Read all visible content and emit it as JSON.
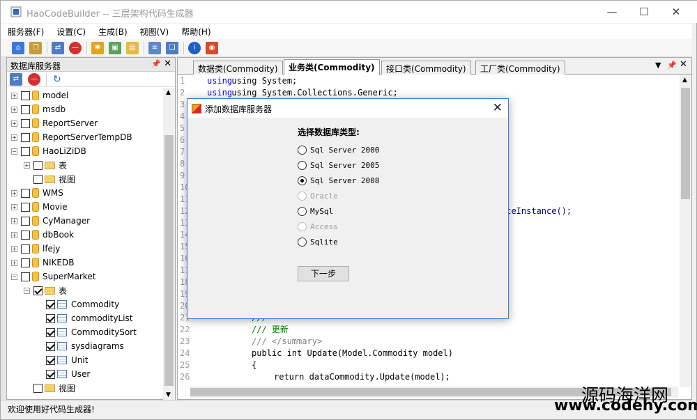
{
  "window": {
    "title": "HaoCodeBuilder -- 三层架构代码生成器"
  },
  "menu": [
    "服务器(F)",
    "设置(C)",
    "生成(B)",
    "视图(V)",
    "帮助(H)"
  ],
  "left_pane": {
    "title": "数据库服务器",
    "tree": [
      {
        "label": "model",
        "type": "db",
        "depth": 0
      },
      {
        "label": "msdb",
        "type": "db",
        "depth": 0
      },
      {
        "label": "ReportServer",
        "type": "db",
        "depth": 0
      },
      {
        "label": "ReportServerTempDB",
        "type": "db",
        "depth": 0
      },
      {
        "label": "HaoLiZiDB",
        "type": "db",
        "depth": 0
      },
      {
        "label": "表",
        "type": "folder",
        "depth": 1
      },
      {
        "label": "视图",
        "type": "folder",
        "depth": 1
      },
      {
        "label": "WMS",
        "type": "db",
        "depth": 0
      },
      {
        "label": "Movie",
        "type": "db",
        "depth": 0
      },
      {
        "label": "CyManager",
        "type": "db",
        "depth": 0
      },
      {
        "label": "dbBook",
        "type": "db",
        "depth": 0
      },
      {
        "label": "lfejy",
        "type": "db",
        "depth": 0
      },
      {
        "label": "NIKEDB",
        "type": "db",
        "depth": 0
      },
      {
        "label": "SuperMarket",
        "type": "db",
        "depth": 0
      },
      {
        "label": "表",
        "type": "folder",
        "depth": 1
      },
      {
        "label": "Commodity",
        "type": "table",
        "depth": 2
      },
      {
        "label": "commodityList",
        "type": "table",
        "depth": 2
      },
      {
        "label": "CommoditySort",
        "type": "table",
        "depth": 2
      },
      {
        "label": "sysdiagrams",
        "type": "table",
        "depth": 2
      },
      {
        "label": "Unit",
        "type": "table",
        "depth": 2
      },
      {
        "label": "User",
        "type": "table",
        "depth": 2
      },
      {
        "label": "视图",
        "type": "folder",
        "depth": 1
      }
    ]
  },
  "tabs": [
    "数据类(Commodity)",
    "业务类(Commodity)",
    "接口类(Commodity)",
    "工厂类(Commodity)"
  ],
  "active_tab": "业务类(Commodity)",
  "code": {
    "line_numbers": [
      "1",
      "2",
      "3",
      "4",
      "5",
      "6",
      "7",
      "8",
      "9",
      "10",
      "11",
      "12",
      "13",
      "14",
      "15",
      "16",
      "17",
      "18",
      "19",
      "20",
      "21",
      "22",
      "23",
      "24",
      "25",
      "26"
    ],
    "line1": "using System;",
    "line2": "using System.Collections.Generic;",
    "line12_tail": "ateInstance();",
    "line22": "/// 更新",
    "line23": "/// </summary>",
    "line24": "public int Update(Model.Commodity model)",
    "line25": "{",
    "line26": "return dataCommodity.Update(model);"
  },
  "status": "欢迎使用好代码生成器!",
  "dialog": {
    "title": "添加数据库服务器",
    "heading": "选择数据库类型:",
    "options": [
      {
        "label": "Sql Server 2000",
        "checked": false,
        "disabled": false
      },
      {
        "label": "Sql Server 2005",
        "checked": false,
        "disabled": false
      },
      {
        "label": "Sql Server 2008",
        "checked": true,
        "disabled": false
      },
      {
        "label": "Oracle",
        "checked": false,
        "disabled": true
      },
      {
        "label": "MySql",
        "checked": false,
        "disabled": false
      },
      {
        "label": "Access",
        "checked": false,
        "disabled": true
      },
      {
        "label": "Sqlite",
        "checked": false,
        "disabled": false
      }
    ],
    "next_label": "下一步"
  },
  "watermark": {
    "line1": "源码海洋网",
    "line2": "www.codehy.com"
  }
}
